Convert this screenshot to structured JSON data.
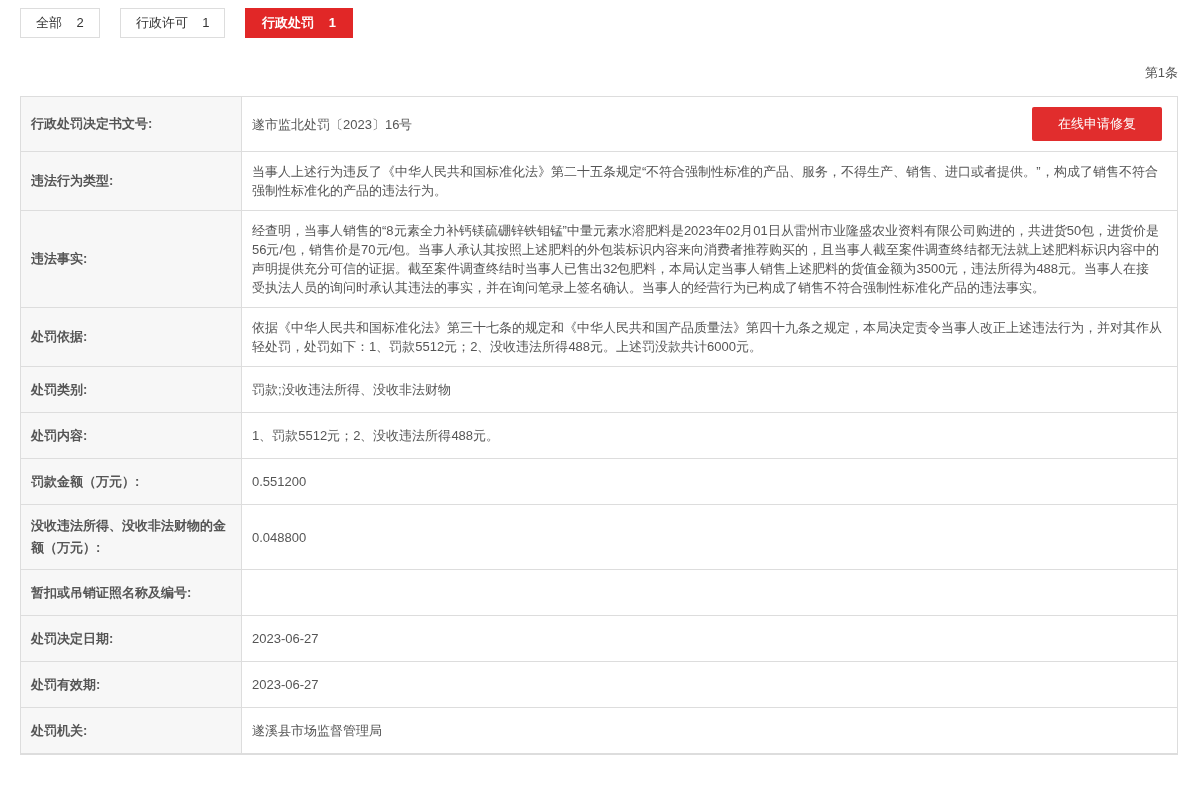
{
  "tabs": [
    {
      "label": "全部",
      "count": "2",
      "selected": false
    },
    {
      "label": "行政许可",
      "count": "1",
      "selected": false
    },
    {
      "label": "行政处罚",
      "count": "1",
      "selected": true
    }
  ],
  "record_index": "第1条",
  "rows": [
    {
      "label": "行政处罚决定书文号:",
      "value": "遂市监北处罚〔2023〕16号",
      "button": "在线申请修复"
    },
    {
      "label": "违法行为类型:",
      "value": "当事人上述行为违反了《中华人民共和国标准化法》第二十五条规定“不符合强制性标准的产品、服务，不得生产、销售、进口或者提供。”，构成了销售不符合强制性标准化的产品的违法行为。"
    },
    {
      "label": "违法事实:",
      "value": "经查明，当事人销售的“8元素全力补钙镁硫硼锌铁钼锰”中量元素水溶肥料是2023年02月01日从雷州市业隆盛农业资料有限公司购进的，共进货50包，进货价是56元/包，销售价是70元/包。当事人承认其按照上述肥料的外包装标识内容来向消费者推荐购买的，且当事人截至案件调查终结都无法就上述肥料标识内容中的声明提供充分可信的证据。截至案件调查终结时当事人已售出32包肥料，本局认定当事人销售上述肥料的货值金额为3500元，违法所得为488元。当事人在接受执法人员的询问时承认其违法的事实，并在询问笔录上签名确认。当事人的经营行为已构成了销售不符合强制性标准化产品的违法事实。"
    },
    {
      "label": "处罚依据:",
      "value": "依据《中华人民共和国标准化法》第三十七条的规定和《中华人民共和国产品质量法》第四十九条之规定，本局决定责令当事人改正上述违法行为，并对其作从轻处罚，处罚如下：1、罚款5512元；2、没收违法所得488元。上述罚没款共计6000元。"
    },
    {
      "label": "处罚类别:",
      "value": "罚款;没收违法所得、没收非法财物"
    },
    {
      "label": "处罚内容:",
      "value": "1、罚款5512元；2、没收违法所得488元。"
    },
    {
      "label": "罚款金额（万元）:",
      "value": "0.551200"
    },
    {
      "label": "没收违法所得、没收非法财物的金额（万元）:",
      "value": "0.048800"
    },
    {
      "label": "暂扣或吊销证照名称及编号:"
    },
    {
      "label": "处罚决定日期:",
      "value": "2023-06-27"
    },
    {
      "label": "处罚有效期:",
      "value": "2023-06-27"
    },
    {
      "label": "处罚机关:",
      "value": "遂溪县市场监督管理局"
    }
  ]
}
